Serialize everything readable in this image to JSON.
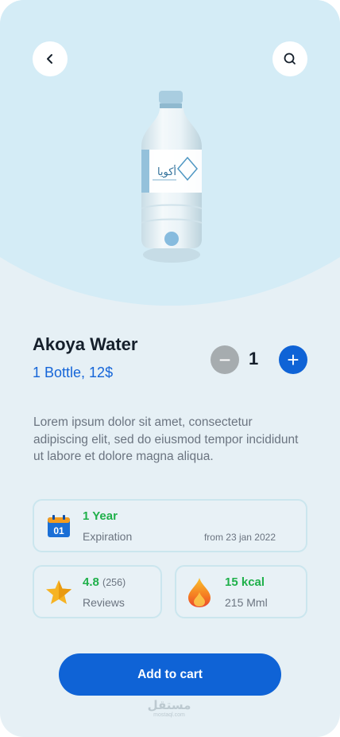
{
  "product": {
    "name": "Akoya Water",
    "price_line": "1 Bottle, 12$",
    "description": "Lorem ipsum dolor sit amet, consectetur adipiscing elit, sed do eiusmod tempor incididunt ut labore et dolore magna aliqua.",
    "bottle_label_text": "أكويا"
  },
  "quantity": {
    "value": "1",
    "minus_symbol": "−",
    "plus_symbol": "+"
  },
  "expiration": {
    "calendar_day": "01",
    "value": "1 Year",
    "label": "Expiration",
    "note": "from 23 jan 2022"
  },
  "reviews": {
    "rating": "4.8",
    "count": "(256)",
    "label": "Reviews"
  },
  "calories": {
    "value": "15 kcal",
    "label": "215 Mml"
  },
  "actions": {
    "add_to_cart": "Add to cart"
  },
  "watermark": {
    "arabic": "مستقل",
    "latin": "mostaql.com"
  },
  "icons": {
    "back": "chevron-left-icon",
    "search": "search-icon",
    "calendar": "calendar-icon",
    "star": "star-icon",
    "flame": "flame-icon"
  },
  "colors": {
    "accent": "#0f63d6",
    "success": "#1fb04a",
    "hero": "#d4ecf6",
    "background": "#e6f0f5"
  }
}
